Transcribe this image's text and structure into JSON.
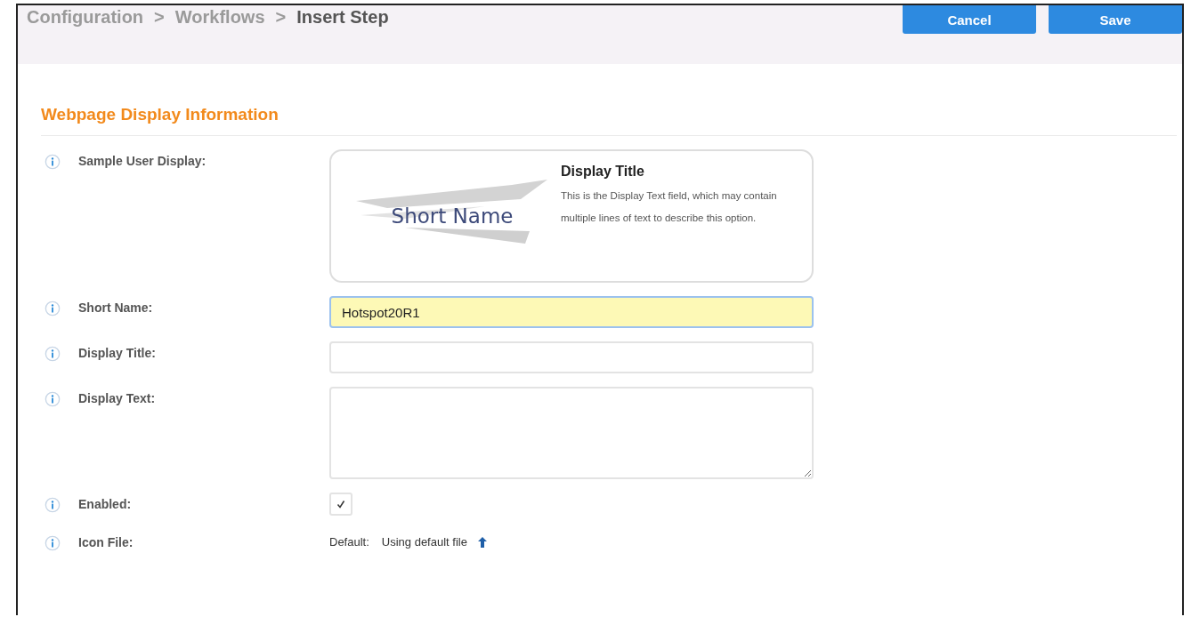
{
  "breadcrumb": [
    {
      "label": "Configuration",
      "current": false
    },
    {
      "label": "Workflows",
      "current": false
    },
    {
      "label": "Insert Step",
      "current": true
    }
  ],
  "breadcrumb_separator": ">",
  "buttons": [
    {
      "label": "Cancel"
    },
    {
      "label": "Save"
    }
  ],
  "section_title": "Webpage Display Information",
  "preview": {
    "label": "Sample User Display:",
    "short_name": "Short Name",
    "title": "Display Title",
    "text": "This is the Display Text field, which may contain multiple lines of text to describe this option."
  },
  "fields": [
    {
      "kind": "input",
      "label": "Short Name:",
      "value": "Hotspot20R1",
      "focused": true
    },
    {
      "kind": "input",
      "label": "Display Title:",
      "focused": false
    },
    {
      "kind": "textarea",
      "label": "Display Text:",
      "focused": false
    },
    {
      "kind": "checkbox",
      "label": "Enabled:",
      "checked": true
    },
    {
      "kind": "file",
      "label": "Icon File:",
      "option": "Default:",
      "value": "Using default file"
    }
  ]
}
